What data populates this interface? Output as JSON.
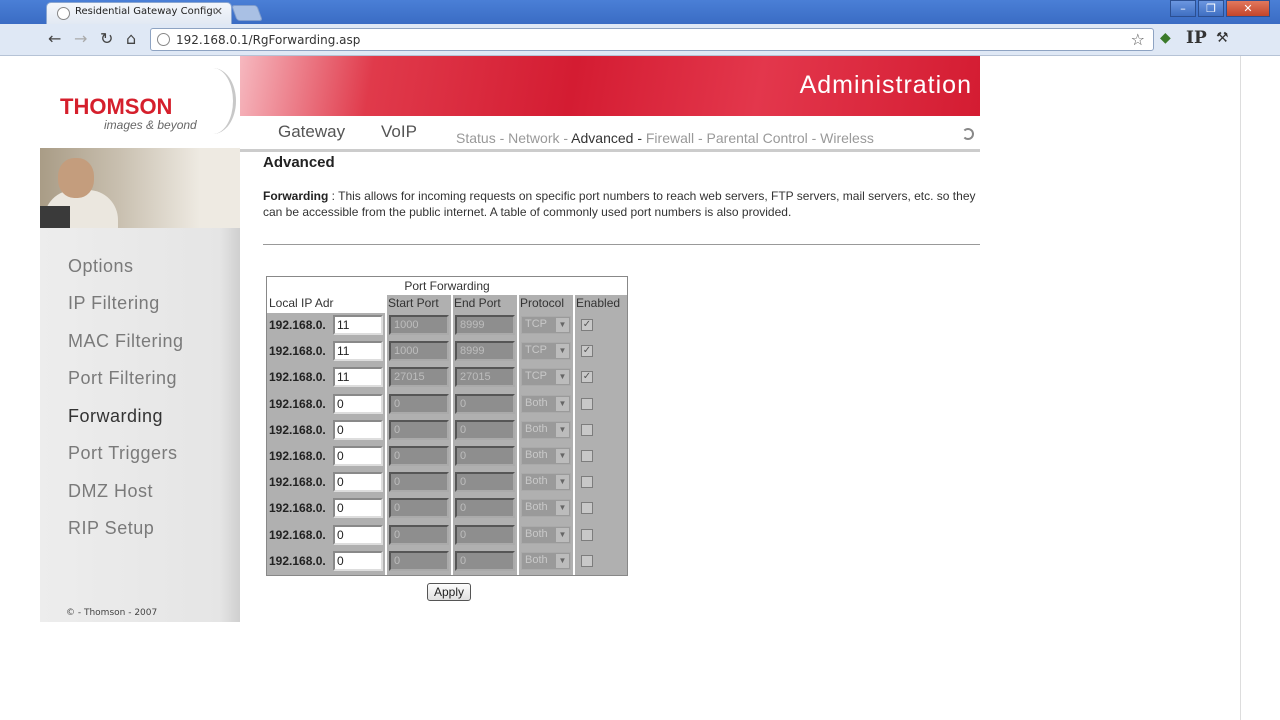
{
  "browser": {
    "tab_title": "Residential Gateway Configura",
    "url": "192.168.0.1/RgForwarding.asp",
    "win_min": "–",
    "win_restore": "❐",
    "win_close": "✕",
    "tab_close": "✕",
    "ip_icon_label": "IP"
  },
  "brand": {
    "name": "THOMSON",
    "tagline": "images & beyond",
    "header_title": "Administration"
  },
  "menu": {
    "main": [
      "Gateway",
      "VoIP"
    ],
    "sub": [
      "Status - ",
      "Network - ",
      "Advanced - ",
      "Firewall - ",
      "Parental Control - ",
      "Wireless"
    ],
    "active_sub_index": 2
  },
  "sidebar": {
    "items": [
      "Options",
      "IP Filtering",
      "MAC Filtering",
      "Port Filtering",
      "Forwarding",
      "Port Triggers",
      "DMZ Host",
      "RIP Setup"
    ],
    "active_index": 4,
    "copyright": "© - Thomson - 2007"
  },
  "content": {
    "heading": "Advanced",
    "desc_label": "Forwarding",
    "desc_sep": " : ",
    "desc_text": " This allows for incoming requests on specific port numbers to reach web servers, FTP servers, mail servers, etc. so they can be accessible from the public internet. A table of commonly used port numbers is also provided."
  },
  "port_forwarding": {
    "title": "Port Forwarding",
    "headers": [
      "Local IP Adr",
      "Start Port",
      "End Port",
      "Protocol",
      "Enabled"
    ],
    "ip_prefix": "192.168.0.",
    "rows": [
      {
        "ip": "11",
        "start": "1000",
        "end": "8999",
        "protocol": "TCP",
        "enabled": true
      },
      {
        "ip": "11",
        "start": "1000",
        "end": "8999",
        "protocol": "TCP",
        "enabled": true
      },
      {
        "ip": "11",
        "start": "27015",
        "end": "27015",
        "protocol": "TCP",
        "enabled": true
      },
      {
        "ip": "0",
        "start": "0",
        "end": "0",
        "protocol": "Both",
        "enabled": false
      },
      {
        "ip": "0",
        "start": "0",
        "end": "0",
        "protocol": "Both",
        "enabled": false
      },
      {
        "ip": "0",
        "start": "0",
        "end": "0",
        "protocol": "Both",
        "enabled": false
      },
      {
        "ip": "0",
        "start": "0",
        "end": "0",
        "protocol": "Both",
        "enabled": false
      },
      {
        "ip": "0",
        "start": "0",
        "end": "0",
        "protocol": "Both",
        "enabled": false
      },
      {
        "ip": "0",
        "start": "0",
        "end": "0",
        "protocol": "Both",
        "enabled": false
      },
      {
        "ip": "0",
        "start": "0",
        "end": "0",
        "protocol": "Both",
        "enabled": false
      }
    ],
    "apply_label": "Apply"
  }
}
